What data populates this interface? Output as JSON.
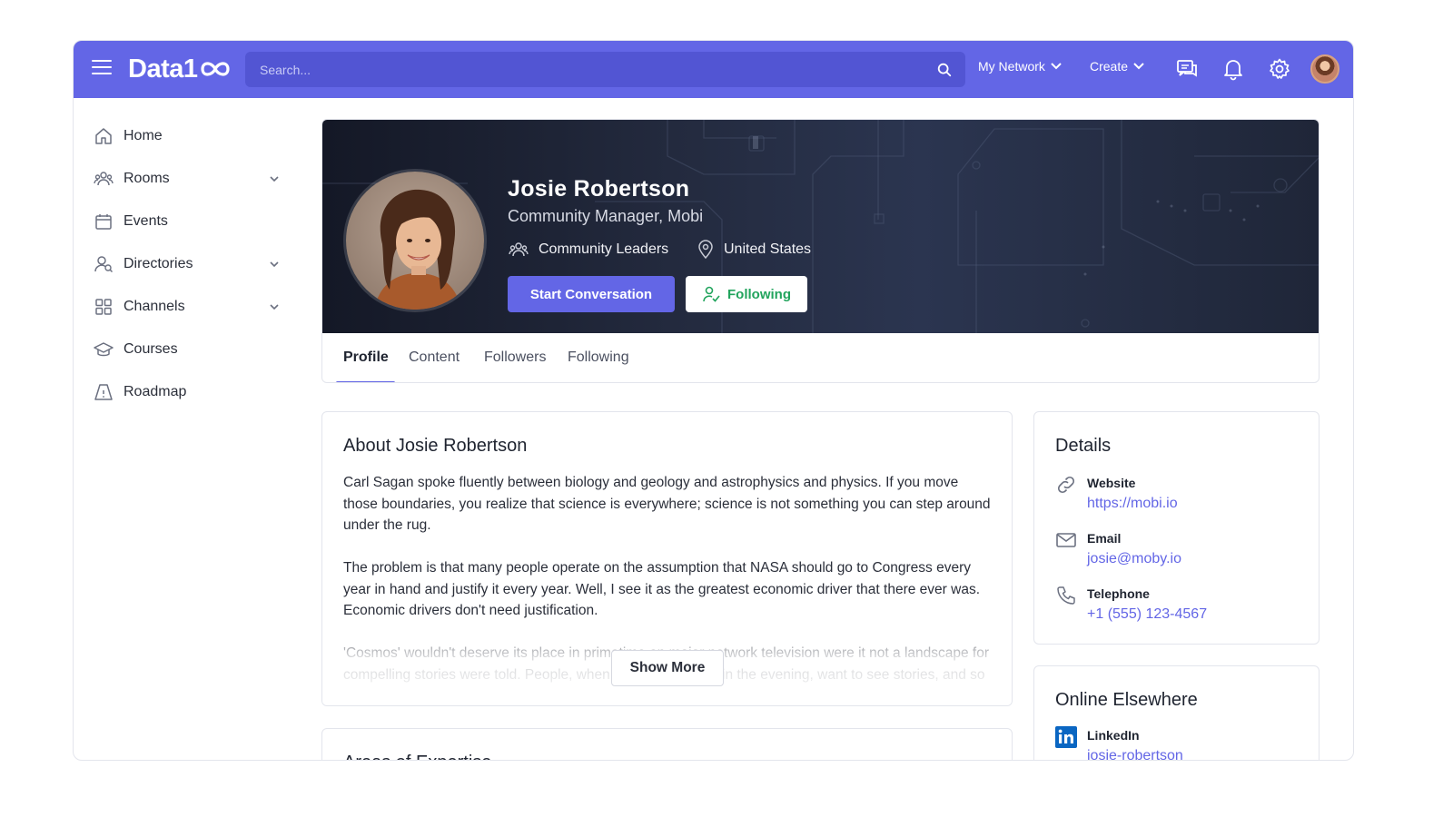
{
  "topbar": {
    "logo": "Data1",
    "search_placeholder": "Search...",
    "my_network": "My Network",
    "create": "Create",
    "colors": {
      "bar": "#6366e6",
      "search": "#5255d3"
    }
  },
  "sidebar": {
    "items": [
      {
        "label": "Home",
        "icon": "home-icon"
      },
      {
        "label": "Rooms",
        "icon": "people-icon"
      },
      {
        "label": "Events",
        "icon": "calendar-icon"
      },
      {
        "label": "Directories",
        "icon": "user-search-icon"
      },
      {
        "label": "Channels",
        "icon": "grid-icon"
      },
      {
        "label": "Courses",
        "icon": "graduation-cap-icon"
      },
      {
        "label": "Roadmap",
        "icon": "map-icon"
      }
    ]
  },
  "profile": {
    "name": "Josie Robertson",
    "role": "Community Manager, Mobi",
    "group": "Community Leaders",
    "location": "United States",
    "start_conversation": "Start Conversation",
    "following_button": "Following",
    "tabs": [
      "Profile",
      "Content",
      "Followers",
      "Following"
    ]
  },
  "about": {
    "title": "About Josie Robertson",
    "text": "Carl Sagan spoke fluently between biology and geology and astrophysics and physics. If you move those boundaries, you realize that science is everywhere; science is not something you can step around under the rug.\n\nThe problem is that many people operate on the assumption that NASA should go to Congress every year in hand and justify it every year. Well, I see it as the greatest economic driver that there ever was. Economic drivers don't need justification.\n\n'Cosmos' wouldn't deserve its place in primetime on major network television were it not a landscape for compelling stories were told. People, when they come home in the evening, want to see stories, and so",
    "show_more": "Show More"
  },
  "expertise": {
    "title": "Areas of Expertise"
  },
  "details": {
    "title": "Details",
    "website_label": "Website",
    "website": "https://mobi.io",
    "email_label": "Email",
    "email": "josie@moby.io",
    "phone_label": "Telephone",
    "phone": "+1 (555) 123-4567"
  },
  "online": {
    "title": "Online Elsewhere",
    "linkedin_label": "LinkedIn",
    "linkedin": "josie-robertson"
  }
}
